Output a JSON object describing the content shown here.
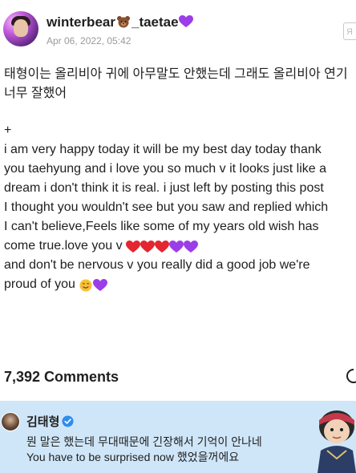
{
  "post": {
    "author": "winterbear",
    "author_suffix": "_taetae",
    "author_bear_icon": "bear-face-icon",
    "author_heart_icon": "purple-heart-icon",
    "date": "Apr 06, 2022, 05:42",
    "translate_label": "Я",
    "lines_korean": [
      "태형이는 올리비아 귀에 아무말도 안했는데 그래도 올리비아 연기",
      "너무 잘했어"
    ],
    "plus": "+",
    "lines_english": [
      "i am very happy today it will be my best day today thank",
      "you taehyung and i love you so much v  it looks just like a",
      "dream i don't think it is real. i just left by posting this post",
      "I thought you wouldn't see but you saw and replied which",
      "I can't believe,Feels like some of my years old wish has",
      "come true.love you v",
      "and don't be nervous v you really did a good job we're",
      "proud of you"
    ],
    "hearts_after_love_you": [
      "red",
      "red",
      "red",
      "purple",
      "purple"
    ],
    "emoji_after_proud": [
      "smile-icon",
      "purple-heart-icon"
    ]
  },
  "comments": {
    "count_label": "7,392 Comments"
  },
  "comment": {
    "author": "김태형",
    "verified_icon": "verified-badge-icon",
    "line1": "뭔 말은 했는데 무대때문에 긴장해서 기억이 안나네",
    "line2": "You have to be surprised now 했었을꺼에요"
  },
  "colors": {
    "comment_bg": "#cfe6f8",
    "verified": "#2f8cf0",
    "heart_red": "#e3262f",
    "heart_purple": "#9b3de8",
    "date": "#9a9a9a"
  }
}
